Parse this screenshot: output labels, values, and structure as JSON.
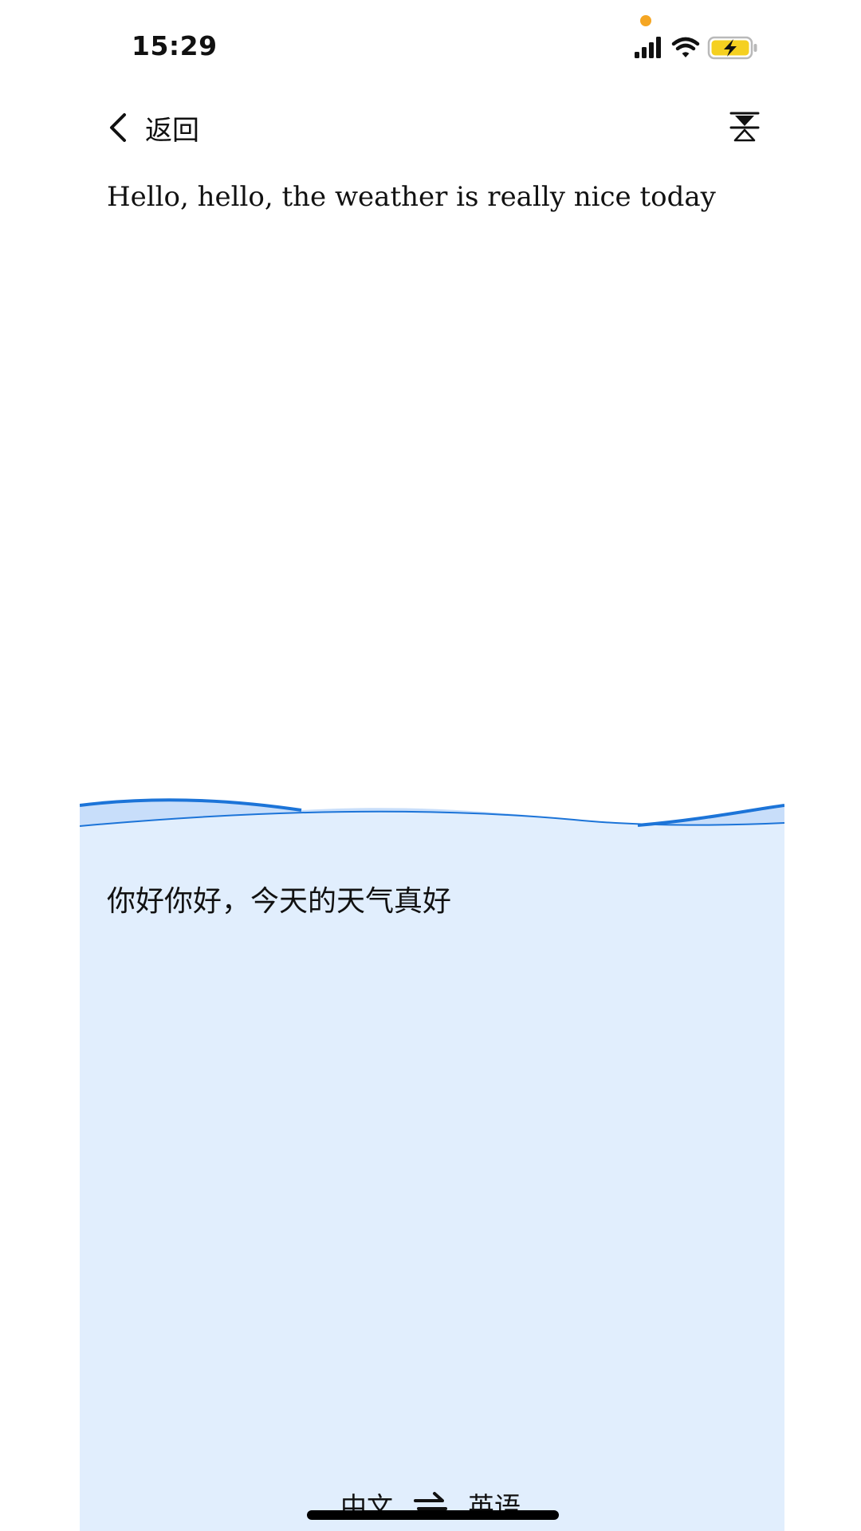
{
  "status_bar": {
    "time": "15:29",
    "privacy_indicator_color": "#f5a623",
    "icons": [
      "cellular-signal-icon",
      "wifi-icon",
      "battery-charging-icon"
    ],
    "battery_color": "#f5d020"
  },
  "nav": {
    "back_label": "返回",
    "back_icon": "chevron-left-icon",
    "swap_layout_icon": "hourglass-flip-icon"
  },
  "source": {
    "text": "Hello, hello, the weather is really nice today"
  },
  "translation": {
    "text": "你好你好，今天的天气真好"
  },
  "language_switch": {
    "from": "中文",
    "to": "英语",
    "icon": "swap-arrows-icon"
  },
  "colors": {
    "panel_background": "#e1eefd",
    "wave_stroke": "#1c74d8",
    "wave_fill": "#c8defa",
    "text": "#111111"
  }
}
